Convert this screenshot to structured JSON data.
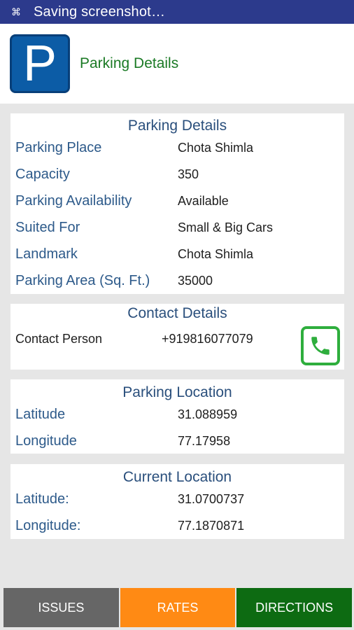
{
  "status_bar": {
    "icon": "screenshot-icon",
    "text": "Saving screenshot…"
  },
  "header": {
    "title": "Parking Details",
    "logo_letter": "P"
  },
  "parking_details": {
    "heading": "Parking Details",
    "rows": [
      {
        "label": "Parking Place",
        "value": "Chota Shimla"
      },
      {
        "label": "Capacity",
        "value": "350"
      },
      {
        "label": "Parking Availability",
        "value": "Available"
      },
      {
        "label": "Suited For",
        "value": "Small & Big Cars"
      },
      {
        "label": "Landmark",
        "value": "Chota Shimla"
      },
      {
        "label": "Parking Area (Sq. Ft.)",
        "value": "35000"
      }
    ]
  },
  "contact_details": {
    "heading": "Contact Details",
    "label": "Contact Person",
    "phone": "+919816077079"
  },
  "parking_location": {
    "heading": "Parking Location",
    "latitude_label": "Latitude",
    "latitude": "31.088959",
    "longitude_label": "Longitude",
    "longitude": "77.17958"
  },
  "current_location": {
    "heading": "Current Location",
    "latitude_label": "Latitude:",
    "latitude": "31.0700737",
    "longitude_label": "Longitude:",
    "longitude": "77.1870871"
  },
  "bottom_buttons": {
    "issues": "ISSUES",
    "rates": "RATES",
    "directions": "DIRECTIONS"
  },
  "colors": {
    "status_bar": "#2c3a8c",
    "header_title": "#1b7a25",
    "heading": "#2a4f7c",
    "label": "#2d5a8a",
    "issues": "#666666",
    "rates": "#ff8a14",
    "directions": "#0d6b12",
    "phone_green": "#2eae3d"
  }
}
